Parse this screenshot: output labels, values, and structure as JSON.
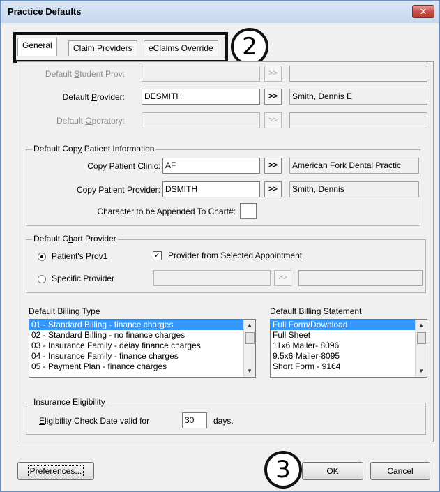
{
  "window": {
    "title": "Practice Defaults",
    "close_glyph": "✕"
  },
  "tabs": [
    {
      "label": "General",
      "active": true
    },
    {
      "label": "Claim Providers",
      "active": false
    },
    {
      "label": "eClaims Override",
      "active": false
    }
  ],
  "callouts": {
    "tabs_number": "2",
    "ok_number": "3"
  },
  "providers": {
    "student_label_pre": "Default ",
    "student_label_key": "S",
    "student_label_post": "tudent Prov:",
    "student_value": "",
    "student_name": "",
    "provider_label_pre": "Default ",
    "provider_label_key": "P",
    "provider_label_post": "rovider:",
    "provider_value": "DESMITH",
    "provider_name": "Smith, Dennis E",
    "operatory_label_pre": "Default ",
    "operatory_label_key": "O",
    "operatory_label_post": "peratory:",
    "operatory_value": "",
    "operatory_name": "",
    "pick_glyph": ">>"
  },
  "copy_patient": {
    "title_pre": "Default Cop",
    "title_key": "y",
    "title_post": " Patient Information",
    "clinic_label": "Copy Patient Clinic:",
    "clinic_value": "AF",
    "clinic_name": "American Fork Dental Practic",
    "provider_label": "Copy Patient Provider:",
    "provider_value": "DSMITH",
    "provider_name": "Smith, Dennis",
    "append_label": "Character to be Appended To Chart#:",
    "append_value": ""
  },
  "chart_provider": {
    "title_pre": "Default C",
    "title_key": "h",
    "title_post": "art Provider",
    "option1": "Patient's Prov1",
    "option1_selected": true,
    "option2": "Specific Provider",
    "option2_selected": false,
    "checkbox_label": "Provider from Selected Appointment",
    "checkbox_checked": true,
    "checkbox_glyph": "✓"
  },
  "billing_type": {
    "label": "Default Billing Type",
    "items": [
      "01 - Standard Billing - finance charges",
      "02 - Standard Billing - no finance charges",
      "03 - Insurance Family - delay finance charges",
      "04 - Insurance Family - finance charges",
      "05 - Payment Plan - finance charges"
    ],
    "selected_index": 0
  },
  "billing_statement": {
    "label": "Default Billing Statement",
    "items": [
      "Full Form/Download",
      "Full Sheet",
      "11x6 Mailer- 8096",
      "9.5x6 Mailer-8095",
      "Short Form - 9164"
    ],
    "selected_index": 0
  },
  "insurance": {
    "title": "Insurance Eligibility",
    "label_key": "E",
    "label_post": "ligibility Check Date valid for",
    "days_value": "30",
    "days_label": "days."
  },
  "buttons": {
    "preferences_key": "P",
    "preferences_post": "references...",
    "ok": "OK",
    "cancel": "Cancel"
  }
}
